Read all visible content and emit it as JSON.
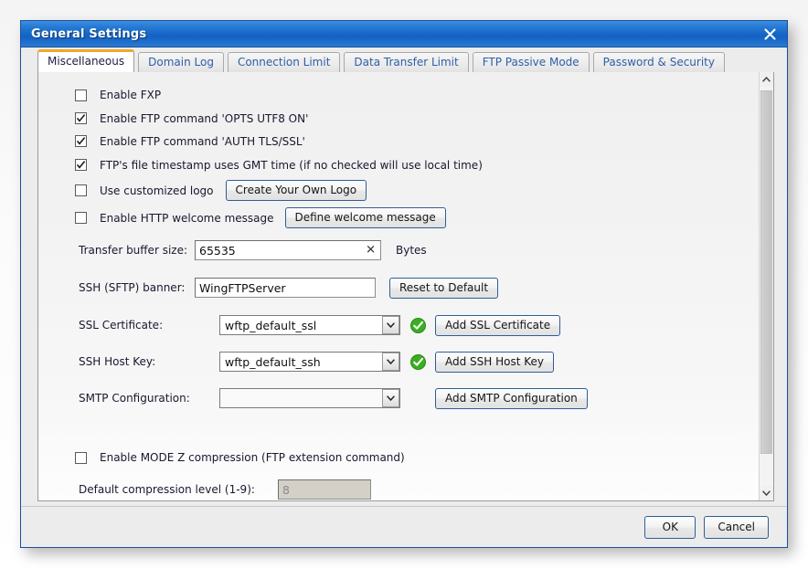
{
  "window": {
    "title": "General Settings",
    "close_icon": "close-icon"
  },
  "tabs": [
    {
      "label": "Miscellaneous",
      "active": true
    },
    {
      "label": "Domain Log",
      "active": false
    },
    {
      "label": "Connection Limit",
      "active": false
    },
    {
      "label": "Data Transfer Limit",
      "active": false
    },
    {
      "label": "FTP Passive Mode",
      "active": false
    },
    {
      "label": "Password & Security",
      "active": false
    }
  ],
  "checkboxes": [
    {
      "label": "Enable FXP",
      "checked": false
    },
    {
      "label": "Enable FTP command 'OPTS UTF8 ON'",
      "checked": true
    },
    {
      "label": "Enable FTP command 'AUTH TLS/SSL'",
      "checked": true
    },
    {
      "label": "FTP's file timestamp uses GMT time (if no checked will use local time)",
      "checked": true
    }
  ],
  "logo_row": {
    "checkbox_label": "Use customized logo",
    "checked": false,
    "button_label": "Create Your Own Logo"
  },
  "welcome_row": {
    "checkbox_label": "Enable HTTP welcome message",
    "checked": false,
    "button_label": "Define welcome message"
  },
  "buffer_row": {
    "label": "Transfer buffer size:",
    "value": "65535",
    "clear_icon": "clear-icon",
    "unit": "Bytes"
  },
  "banner_row": {
    "label": "SSH (SFTP) banner:",
    "value": "WingFTPServer",
    "button_label": "Reset to Default"
  },
  "ssl_row": {
    "label": "SSL Certificate:",
    "value": "wftp_default_ssl",
    "status_icon": "check-circle-icon",
    "button_label": "Add SSL Certificate"
  },
  "ssh_row": {
    "label": "SSH Host Key:",
    "value": "wftp_default_ssh",
    "status_icon": "check-circle-icon",
    "button_label": "Add SSH Host Key"
  },
  "smtp_row": {
    "label": "SMTP Configuration:",
    "value": "",
    "button_label": "Add SMTP Configuration"
  },
  "modez_row": {
    "label": "Enable MODE Z compression (FTP extension command)",
    "checked": false
  },
  "compression_row": {
    "label": "Default compression level (1-9):",
    "value": "8"
  },
  "footer": {
    "ok_label": "OK",
    "cancel_label": "Cancel"
  },
  "colors": {
    "title_blue": "#1667c7",
    "active_tab_accent": "#f3a72b",
    "tab_text": "#2d5fa8",
    "status_green": "#2bab2b",
    "button_border": "#2f5d95"
  }
}
